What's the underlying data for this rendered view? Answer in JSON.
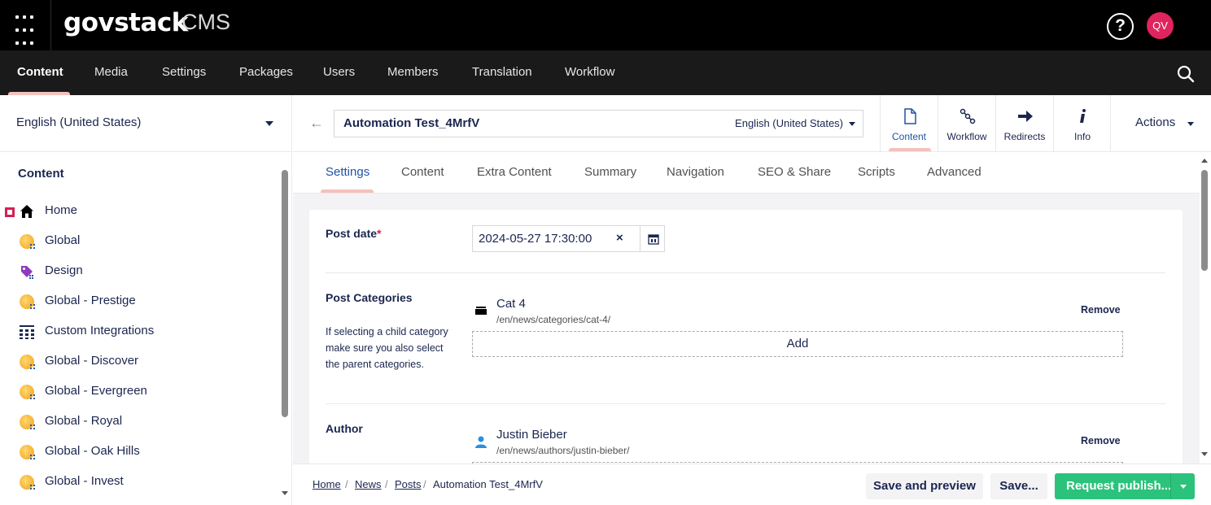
{
  "header": {
    "brand": "govstack",
    "brand_sub": "CMS",
    "help_icon": "?",
    "avatar_initials": "QV"
  },
  "main_nav": {
    "items": [
      {
        "label": "Content",
        "active": true
      },
      {
        "label": "Media"
      },
      {
        "label": "Settings"
      },
      {
        "label": "Packages"
      },
      {
        "label": "Users"
      },
      {
        "label": "Members"
      },
      {
        "label": "Translation"
      },
      {
        "label": "Workflow"
      }
    ]
  },
  "sidebar": {
    "language": "English (United States)",
    "tree_title": "Content",
    "items": [
      {
        "label": "Home",
        "icon": "home-icon"
      },
      {
        "label": "Global",
        "icon": "globe-icon"
      },
      {
        "label": "Design",
        "icon": "tag-icon"
      },
      {
        "label": "Global - Prestige",
        "icon": "globe-icon"
      },
      {
        "label": "Custom Integrations",
        "icon": "grid-icon"
      },
      {
        "label": "Global - Discover",
        "icon": "globe-icon"
      },
      {
        "label": "Global - Evergreen",
        "icon": "globe-icon"
      },
      {
        "label": "Global - Royal",
        "icon": "globe-icon"
      },
      {
        "label": "Global - Oak Hills",
        "icon": "globe-icon"
      },
      {
        "label": "Global - Invest",
        "icon": "globe-icon"
      }
    ]
  },
  "editor": {
    "name": "Automation Test_4MrfV",
    "variant": "English (United States)",
    "apps": [
      {
        "label": "Content",
        "active": true
      },
      {
        "label": "Workflow"
      },
      {
        "label": "Redirects"
      },
      {
        "label": "Info"
      }
    ],
    "actions_label": "Actions"
  },
  "tabs": [
    "Settings",
    "Content",
    "Extra Content",
    "Summary",
    "Navigation",
    "SEO & Share",
    "Scripts",
    "Advanced"
  ],
  "properties": {
    "post_date": {
      "label": "Post date",
      "required": "*",
      "value": "2024-05-27 17:30:00",
      "clear": "×"
    },
    "post_categories": {
      "label": "Post Categories",
      "description": "If selecting a child category make sure you also select the parent categories.",
      "item_name": "Cat 4",
      "item_url": "/en/news/categories/cat-4/",
      "remove_label": "Remove",
      "add_label": "Add"
    },
    "author": {
      "label": "Author",
      "item_name": "Justin Bieber",
      "item_url": "/en/news/authors/justin-bieber/",
      "remove_label": "Remove"
    }
  },
  "footer": {
    "breadcrumb": [
      "Home",
      "News",
      "Posts",
      "Automation Test_4MrfV"
    ],
    "save_preview": "Save and preview",
    "save": "Save...",
    "publish": "Request publish..."
  },
  "colors": {
    "accent_pink": "#f5c1bc",
    "publish_green": "#2bc37c",
    "avatar_red": "#e0245e",
    "link_blue": "#2152a3"
  }
}
